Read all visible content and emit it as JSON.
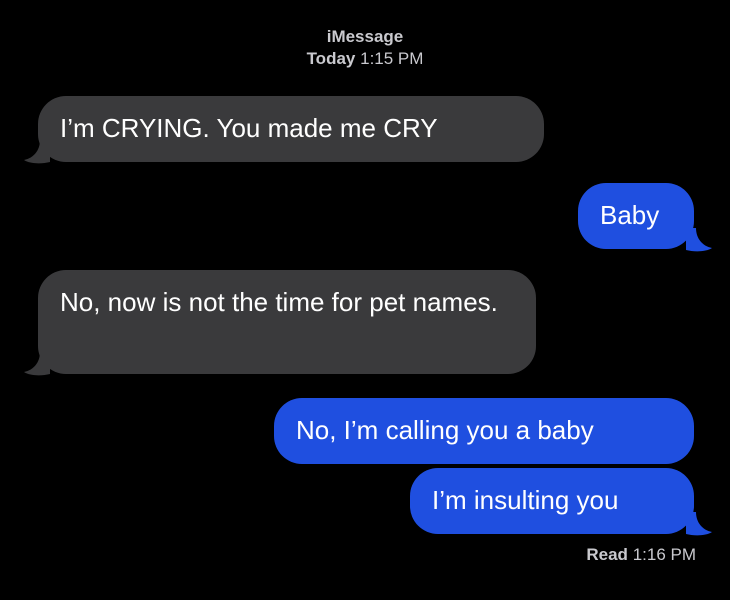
{
  "header": {
    "service": "iMessage",
    "day": "Today",
    "time": "1:15 PM"
  },
  "messages": [
    {
      "from": "them",
      "text": "I’m CRYING. You made me CRY"
    },
    {
      "from": "me",
      "text": "Baby"
    },
    {
      "from": "them",
      "text": "No, now is not the time for pet names."
    },
    {
      "from": "me",
      "text": "No, I’m calling you a baby"
    },
    {
      "from": "me",
      "text": "I’m insulting you"
    }
  ],
  "receipt": {
    "label": "Read",
    "time": "1:16 PM"
  },
  "colors": {
    "background": "#000000",
    "incoming_bubble": "#3a3a3c",
    "outgoing_bubble": "#1f4fe0",
    "meta_text": "#c9c9ce"
  }
}
